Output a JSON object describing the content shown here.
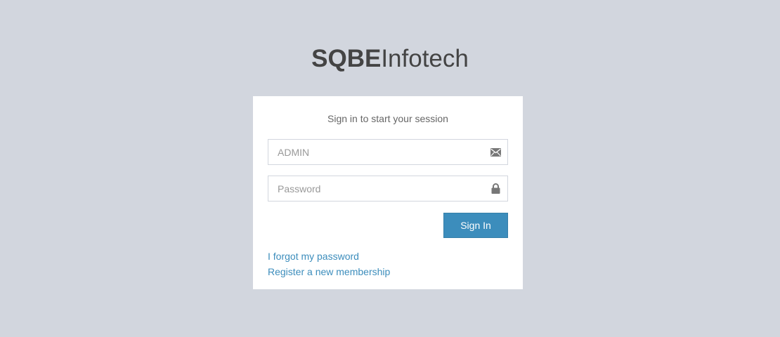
{
  "logo": {
    "bold": "SQBE",
    "light": "Infotech"
  },
  "login": {
    "message": "Sign in to start your session",
    "username": {
      "value": "",
      "placeholder": "ADMIN",
      "icon": "envelope-icon"
    },
    "password": {
      "value": "",
      "placeholder": "Password",
      "icon": "lock-icon"
    },
    "signin_label": "Sign In",
    "forgot_label": "I forgot my password",
    "register_label": "Register a new membership"
  },
  "colors": {
    "background": "#d2d6de",
    "primary": "#3c8dbc",
    "link": "#3c8dbc"
  }
}
